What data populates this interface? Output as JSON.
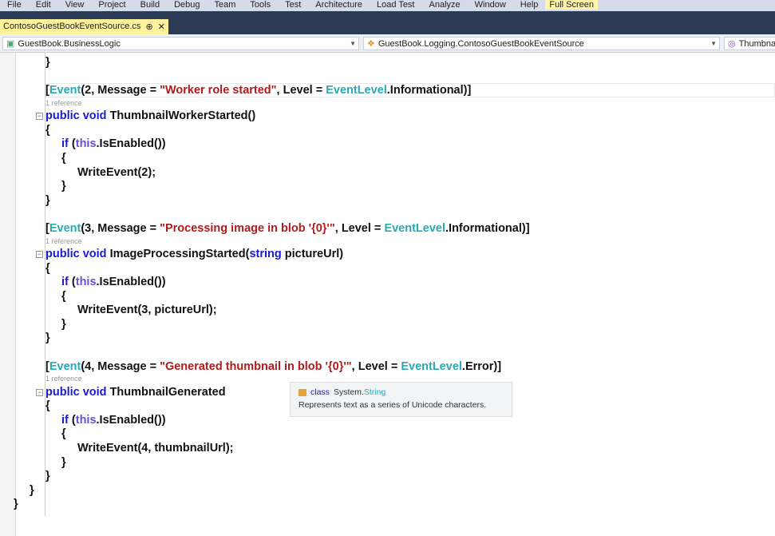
{
  "menu": [
    "File",
    "Edit",
    "View",
    "Project",
    "Build",
    "Debug",
    "Team",
    "Tools",
    "Test",
    "Architecture",
    "Load Test",
    "Analyze",
    "Window",
    "Help",
    "Full Screen"
  ],
  "tab": {
    "label": "ContosoGuestBookEventSource.cs",
    "pin": "⊕",
    "close": "✕"
  },
  "nav": {
    "project": "GuestBook.BusinessLogic",
    "type": "GuestBook.Logging.ContosoGuestBookEventSource",
    "member": "Thumbnail"
  },
  "code": [
    {
      "i": 2,
      "tk": [
        [
          "}",
          ""
        ]
      ]
    },
    {
      "blank": true
    },
    {
      "i": 2,
      "tk": [
        [
          "[",
          ""
        ],
        [
          "Event",
          "t"
        ],
        [
          "(2, Message = ",
          ""
        ],
        [
          "\"Worker role started\"",
          "s"
        ],
        [
          ", Level = ",
          ""
        ],
        [
          "EventLevel",
          "t"
        ],
        [
          ".Informational)]",
          ""
        ]
      ]
    },
    {
      "ref": "1 reference",
      "i": 2
    },
    {
      "i": 2,
      "fold": true,
      "tk": [
        [
          "public void ",
          "k"
        ],
        [
          "ThumbnailWorkerStarted()",
          ""
        ]
      ]
    },
    {
      "i": 2,
      "tk": [
        [
          "{",
          ""
        ]
      ]
    },
    {
      "i": 3,
      "tk": [
        [
          "if ",
          "k"
        ],
        [
          "(",
          ""
        ],
        [
          "this",
          "th"
        ],
        [
          ".IsEnabled())",
          ""
        ]
      ]
    },
    {
      "i": 3,
      "tk": [
        [
          "{",
          ""
        ]
      ]
    },
    {
      "i": 4,
      "tk": [
        [
          "WriteEvent(2);",
          ""
        ]
      ]
    },
    {
      "i": 3,
      "tk": [
        [
          "}",
          ""
        ]
      ]
    },
    {
      "i": 2,
      "tk": [
        [
          "}",
          ""
        ]
      ]
    },
    {
      "blank": true
    },
    {
      "i": 2,
      "tk": [
        [
          "[",
          ""
        ],
        [
          "Event",
          "t"
        ],
        [
          "(3, Message = ",
          ""
        ],
        [
          "\"Processing image in blob '{0}'\"",
          "s"
        ],
        [
          ", Level = ",
          ""
        ],
        [
          "EventLevel",
          "t"
        ],
        [
          ".Informational)]",
          ""
        ]
      ]
    },
    {
      "ref": "1 reference",
      "i": 2
    },
    {
      "i": 2,
      "fold": true,
      "tk": [
        [
          "public void ",
          "k"
        ],
        [
          "ImageProcessingStarted(",
          ""
        ],
        [
          "string ",
          "k"
        ],
        [
          "pictureUrl)",
          ""
        ]
      ]
    },
    {
      "i": 2,
      "tk": [
        [
          "{",
          ""
        ]
      ]
    },
    {
      "i": 3,
      "tk": [
        [
          "if ",
          "k"
        ],
        [
          "(",
          ""
        ],
        [
          "this",
          "th"
        ],
        [
          ".IsEnabled())",
          ""
        ]
      ]
    },
    {
      "i": 3,
      "tk": [
        [
          "{",
          ""
        ]
      ]
    },
    {
      "i": 4,
      "tk": [
        [
          "WriteEvent(3, pictureUrl);",
          ""
        ]
      ]
    },
    {
      "i": 3,
      "tk": [
        [
          "}",
          ""
        ]
      ]
    },
    {
      "i": 2,
      "tk": [
        [
          "}",
          ""
        ]
      ]
    },
    {
      "blank": true
    },
    {
      "i": 2,
      "tk": [
        [
          "[",
          ""
        ],
        [
          "Event",
          "t"
        ],
        [
          "(4, Message = ",
          ""
        ],
        [
          "\"Generated thumbnail in blob '{0}'\"",
          "s"
        ],
        [
          ", Level = ",
          ""
        ],
        [
          "EventLevel",
          "t"
        ],
        [
          ".Error)]",
          ""
        ]
      ]
    },
    {
      "ref": "1 reference",
      "i": 2
    },
    {
      "i": 2,
      "fold": true,
      "tk": [
        [
          "public void ",
          "k"
        ],
        [
          "ThumbnailGenerated",
          ""
        ]
      ]
    },
    {
      "i": 2,
      "tk": [
        [
          "{",
          ""
        ]
      ]
    },
    {
      "i": 3,
      "tk": [
        [
          "if ",
          "k"
        ],
        [
          "(",
          ""
        ],
        [
          "this",
          "th"
        ],
        [
          ".IsEnabled())",
          ""
        ]
      ]
    },
    {
      "i": 3,
      "tk": [
        [
          "{",
          ""
        ]
      ]
    },
    {
      "i": 4,
      "tk": [
        [
          "WriteEvent(4, thumbnailUrl);",
          ""
        ]
      ]
    },
    {
      "i": 3,
      "tk": [
        [
          "}",
          ""
        ]
      ]
    },
    {
      "i": 2,
      "tk": [
        [
          "}",
          ""
        ]
      ]
    },
    {
      "i": 1,
      "tk": [
        [
          "}",
          ""
        ]
      ]
    },
    {
      "i": 0,
      "tk": [
        [
          "}",
          ""
        ]
      ]
    }
  ],
  "tooltip": {
    "keyword": "class",
    "ns": "System.",
    "type": "String",
    "desc": "Represents text as a series of Unicode characters."
  }
}
